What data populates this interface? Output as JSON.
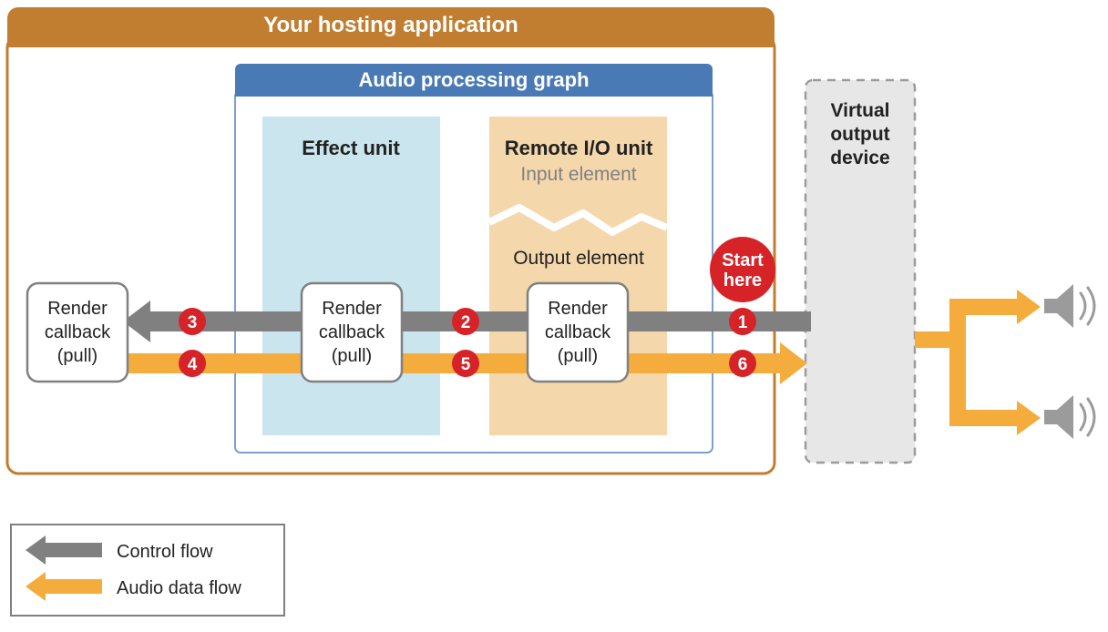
{
  "colors": {
    "host_border": "#c17e30",
    "host_title_bg": "#c17e30",
    "graph_border": "#4a7ab5",
    "graph_title_bg": "#4a7ab5",
    "graph_inner_border": "#7aa0cf",
    "effect_fill": "#cae5ed",
    "remote_fill": "#f5d7ac",
    "virtual_fill": "#e7e7e7",
    "virtual_dash": "#9b9b9b",
    "node_border": "#808080",
    "control_gray": "#808080",
    "audio_orange": "#f4ad3d",
    "badge_red": "#d62328",
    "badge_text": "#ffffff",
    "text_dark": "#222222",
    "text_muted": "#808080"
  },
  "host": {
    "title": "Your hosting application"
  },
  "graph": {
    "title": "Audio processing graph"
  },
  "effect": {
    "title": "Effect unit"
  },
  "remote": {
    "title": "Remote I/O unit",
    "input_label": "Input element",
    "output_label": "Output element"
  },
  "virtual": {
    "line1": "Virtual",
    "line2": "output",
    "line3": "device"
  },
  "callbacks": {
    "left": {
      "line1": "Render",
      "line2": "callback",
      "line3": "(pull)"
    },
    "center": {
      "line1": "Render",
      "line2": "callback",
      "line3": "(pull)"
    },
    "right": {
      "line1": "Render",
      "line2": "callback",
      "line3": "(pull)"
    }
  },
  "start_badge": {
    "line1": "Start",
    "line2": "here"
  },
  "badges": {
    "b1": "1",
    "b2": "2",
    "b3": "3",
    "b4": "4",
    "b5": "5",
    "b6": "6"
  },
  "legend": {
    "control": "Control flow",
    "audio": "Audio data flow"
  }
}
